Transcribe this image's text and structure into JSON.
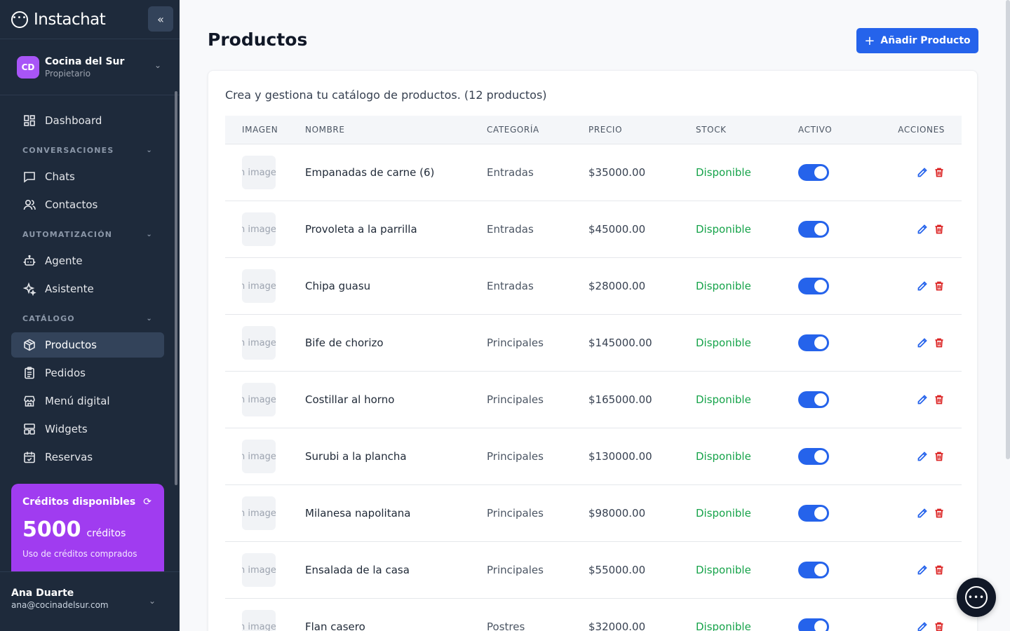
{
  "brand": {
    "name": "Instachat",
    "logo_icon": "chat-dots-icon"
  },
  "org": {
    "initials": "CD",
    "name": "Cocina del Sur",
    "role": "Propietario"
  },
  "nav": {
    "dashboard": "Dashboard",
    "section_conversaciones": "CONVERSACIONES",
    "chats": "Chats",
    "contactos": "Contactos",
    "section_automatizacion": "AUTOMATIZACIÓN",
    "agente": "Agente",
    "asistente": "Asistente",
    "section_catalogo": "CATÁLOGO",
    "productos": "Productos",
    "pedidos": "Pedidos",
    "menu_digital": "Menú digital",
    "widgets": "Widgets",
    "reservas": "Reservas"
  },
  "credits": {
    "title": "Créditos disponibles",
    "amount": "5000",
    "unit": "créditos",
    "note": "Uso de créditos comprados"
  },
  "user": {
    "name": "Ana Duarte",
    "email": "ana@cocinadelsur.com"
  },
  "page": {
    "title": "Productos",
    "add_button": "Añadir Producto",
    "description": "Crea y gestiona tu catálogo de productos. (12 productos)"
  },
  "table": {
    "headers": {
      "image": "IMAGEN",
      "name": "NOMBRE",
      "category": "CATEGORÍA",
      "price": "PRECIO",
      "stock": "STOCK",
      "active": "ACTIVO",
      "actions": "ACCIONES"
    },
    "image_placeholder": "n image",
    "rows": [
      {
        "name": "Empanadas de carne (6)",
        "category": "Entradas",
        "price": "$35000.00",
        "stock": "Disponible",
        "active": true
      },
      {
        "name": "Provoleta a la parrilla",
        "category": "Entradas",
        "price": "$45000.00",
        "stock": "Disponible",
        "active": true
      },
      {
        "name": "Chipa guasu",
        "category": "Entradas",
        "price": "$28000.00",
        "stock": "Disponible",
        "active": true
      },
      {
        "name": "Bife de chorizo",
        "category": "Principales",
        "price": "$145000.00",
        "stock": "Disponible",
        "active": true
      },
      {
        "name": "Costillar al horno",
        "category": "Principales",
        "price": "$165000.00",
        "stock": "Disponible",
        "active": true
      },
      {
        "name": "Surubi a la plancha",
        "category": "Principales",
        "price": "$130000.00",
        "stock": "Disponible",
        "active": true
      },
      {
        "name": "Milanesa napolitana",
        "category": "Principales",
        "price": "$98000.00",
        "stock": "Disponible",
        "active": true
      },
      {
        "name": "Ensalada de la casa",
        "category": "Principales",
        "price": "$55000.00",
        "stock": "Disponible",
        "active": true
      },
      {
        "name": "Flan casero",
        "category": "Postres",
        "price": "$32000.00",
        "stock": "Disponible",
        "active": true
      }
    ]
  },
  "colors": {
    "sidebar_bg": "#1e2a3b",
    "accent": "#2563eb",
    "credits_bg": "#a03cf0",
    "stock_ok": "#16a34a",
    "delete": "#dc2626"
  }
}
